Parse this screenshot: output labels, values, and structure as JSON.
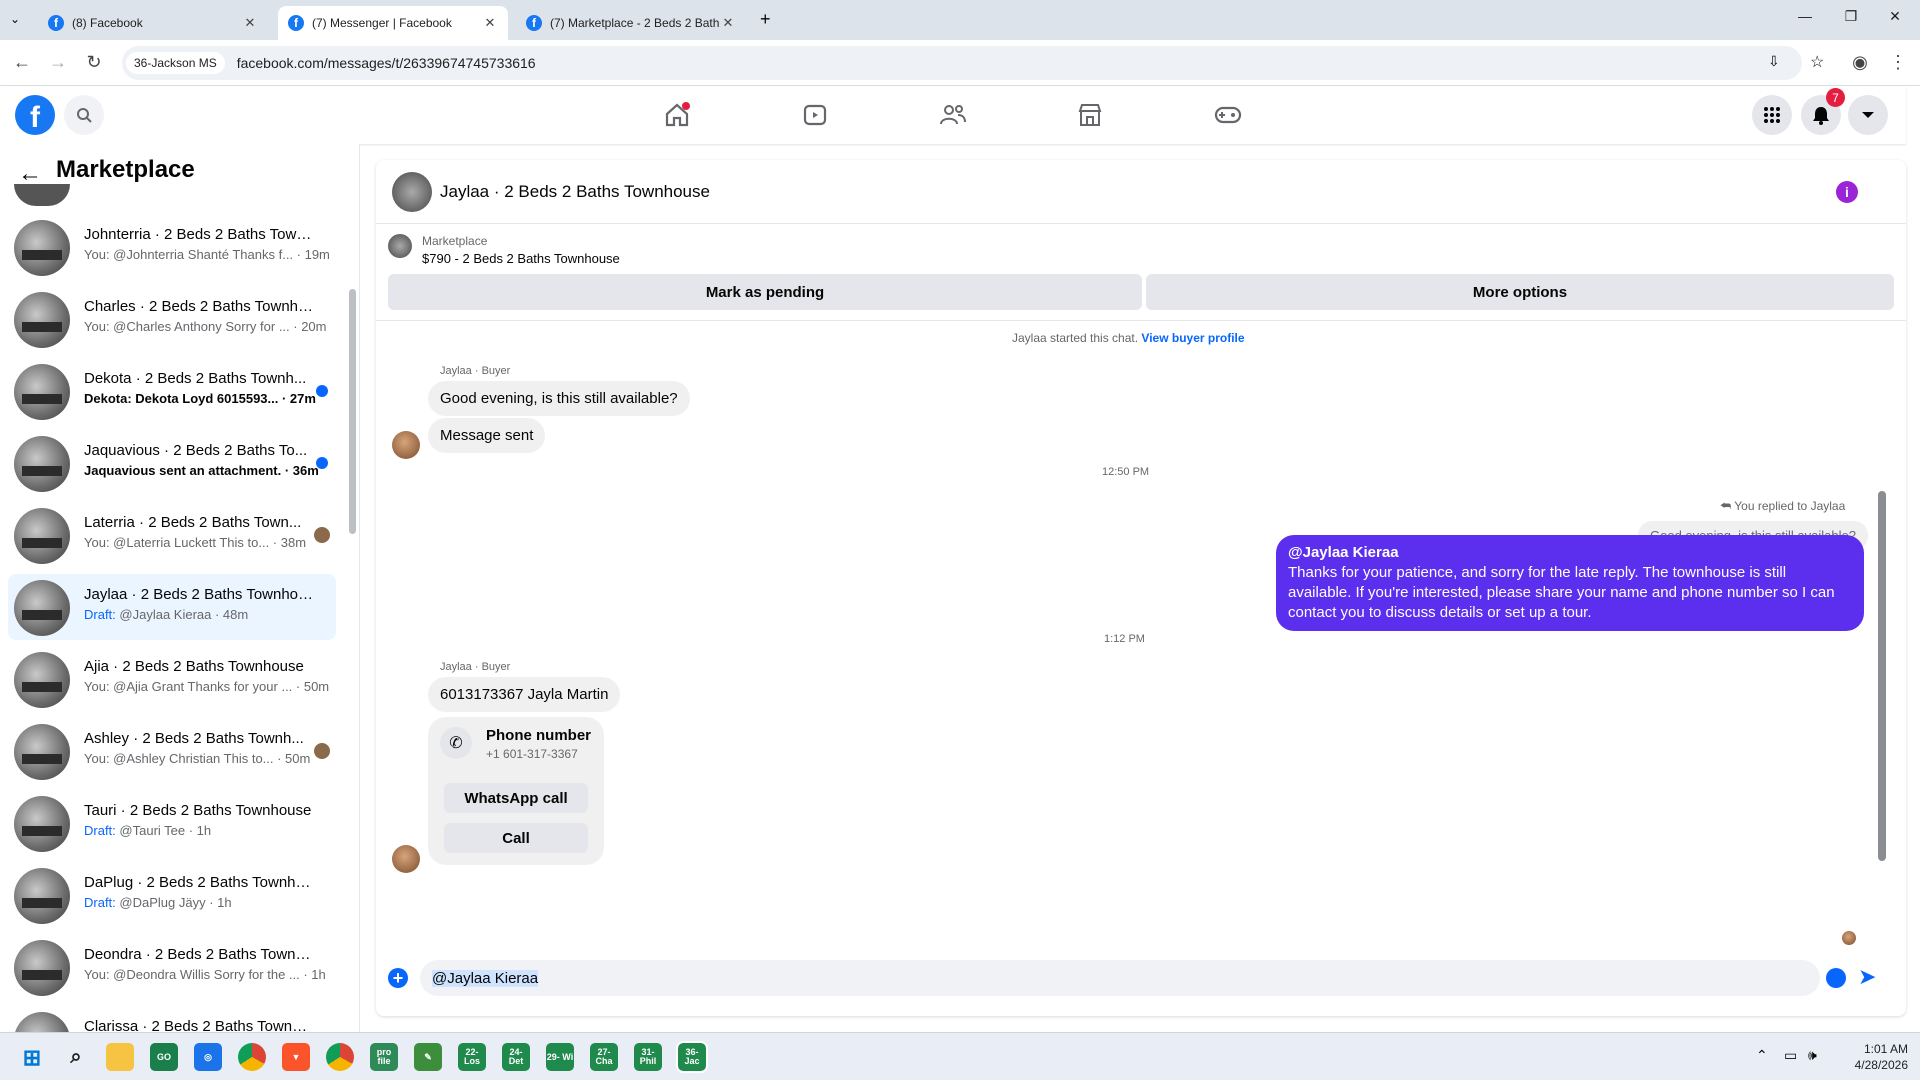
{
  "browser": {
    "tabs": [
      {
        "label": "(8) Facebook",
        "active": false
      },
      {
        "label": "(7) Messenger | Facebook",
        "active": true
      },
      {
        "label": "(7) Marketplace - 2 Beds 2 Bath",
        "active": false
      }
    ],
    "site_chip": "36-Jackson MS",
    "url": "facebook.com/messages/t/26339674745733616"
  },
  "facebook": {
    "logo": "f",
    "notification_count": "7"
  },
  "sidebar": {
    "title": "Marketplace",
    "conversations": [
      {
        "name": "Johnterria · 2 Beds 2 Baths Town...",
        "preview": "You: @Johnterria Shanté Thanks f... · 19m"
      },
      {
        "name": "Charles · 2 Beds 2 Baths Townho...",
        "preview": "You: @Charles Anthony Sorry for ... · 20m"
      },
      {
        "name": "Dekota · 2 Beds 2 Baths Townh...",
        "preview": "Dekota: Dekota Loyd 6015593... · 27m",
        "unread": true
      },
      {
        "name": "Jaquavious · 2 Beds 2 Baths To...",
        "preview": "Jaquavious sent an attachment. · 36m",
        "unread": true
      },
      {
        "name": "Laterria · 2 Beds 2 Baths Town...",
        "preview": "You: @Laterria Luckett This to... · 38m"
      },
      {
        "name": "Jaylaa · 2 Beds 2 Baths Townhouse",
        "draft_label": "Draft:",
        "preview": " @Jaylaa Kieraa · 48m",
        "selected": true
      },
      {
        "name": "Ajia · 2 Beds 2 Baths Townhouse",
        "preview": "You: @Ajia Grant Thanks for your ... · 50m"
      },
      {
        "name": "Ashley · 2 Beds 2 Baths Townh...",
        "preview": "You: @Ashley Christian This to... · 50m"
      },
      {
        "name": "Tauri · 2 Beds 2 Baths Townhouse",
        "draft_label": "Draft:",
        "preview": " @Tauri Tee · 1h"
      },
      {
        "name": "DaPlug · 2 Beds 2 Baths Townho...",
        "draft_label": "Draft:",
        "preview": " @DaPlug Jäyy · 1h"
      },
      {
        "name": "Deondra · 2 Beds 2 Baths Townh...",
        "preview": "You: @Deondra Willis Sorry for the ... · 1h"
      },
      {
        "name": "Clarissa · 2 Beds 2 Baths Townho...",
        "preview": ""
      }
    ]
  },
  "chat": {
    "title": "Jaylaa · 2 Beds 2 Baths Townhouse",
    "listing_source": "Marketplace",
    "listing_title": "$790 - 2 Beds 2 Baths Townhouse",
    "mark_pending": "Mark as pending",
    "more_options": "More options",
    "started_text": "Jaylaa started this chat.",
    "view_profile": "View buyer profile",
    "sender_label": "Jaylaa · Buyer",
    "msg1": "Good evening, is this still available?",
    "msg2": "Message sent",
    "time1": "12:50 PM",
    "replied_label": "You replied to Jaylaa",
    "quoted": "Good evening, is this still available?",
    "out_mention": "@Jaylaa Kieraa",
    "out_text": "Thanks for your patience, and sorry for the late reply. The townhouse is still available. If you're interested, please share your name and phone number so I can contact you to discuss details or set up a tour.",
    "time2": "1:12 PM",
    "sender_label2": "Jaylaa · Buyer",
    "msg3": "6013173367 Jayla Martin",
    "phone_title": "Phone number",
    "phone_value": "+1 601-317-3367",
    "whatsapp": "WhatsApp call",
    "call": "Call",
    "composer_value": "@Jaylaa Kieraa"
  },
  "taskbar": {
    "icons": [
      {
        "label": "GO",
        "color": "#1a7f4b"
      },
      {
        "label": "pro file",
        "color": "#2e8b57"
      },
      {
        "label": "22- Los",
        "color": "#1f8a4c"
      },
      {
        "label": "24- Det",
        "color": "#1f8a4c"
      },
      {
        "label": "29- Wi",
        "color": "#1f8a4c"
      },
      {
        "label": "27- Cha",
        "color": "#1f8a4c"
      },
      {
        "label": "31- Phil",
        "color": "#1f8a4c"
      },
      {
        "label": "36- Jac",
        "color": "#1f8a4c"
      }
    ],
    "time": "1:01 AM",
    "date": "4/28/2026"
  }
}
